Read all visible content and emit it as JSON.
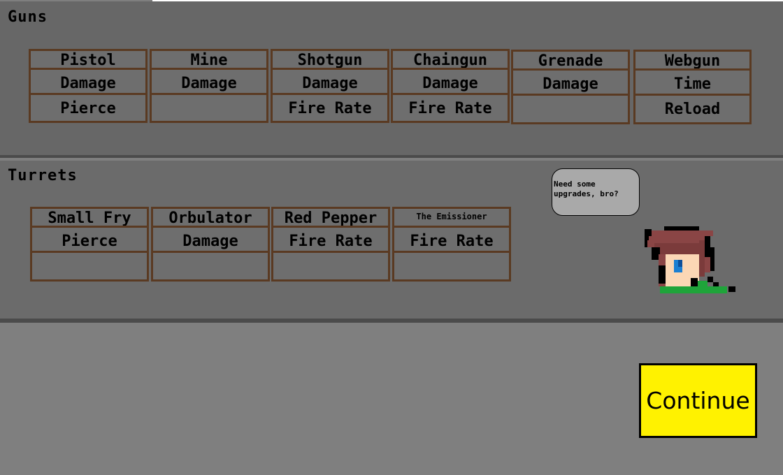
{
  "guns": {
    "title": "Guns",
    "items": [
      {
        "name": "Pistol",
        "upgrade1": "Damage",
        "upgrade2": "Pierce"
      },
      {
        "name": "Mine",
        "upgrade1": "Damage",
        "upgrade2": ""
      },
      {
        "name": "Shotgun",
        "upgrade1": "Damage",
        "upgrade2": "Fire Rate"
      },
      {
        "name": "Chaingun",
        "upgrade1": "Damage",
        "upgrade2": "Fire Rate"
      },
      {
        "name": "Grenade",
        "upgrade1": "Damage",
        "upgrade2": ""
      },
      {
        "name": "Webgun",
        "upgrade1": "Time",
        "upgrade2": "Reload"
      }
    ]
  },
  "turrets": {
    "title": "Turrets",
    "items": [
      {
        "name": "Small Fry",
        "upgrade1": "Pierce",
        "upgrade2": ""
      },
      {
        "name": "Orbulator",
        "upgrade1": "Damage",
        "upgrade2": ""
      },
      {
        "name": "Red Pepper",
        "upgrade1": "Fire Rate",
        "upgrade2": ""
      },
      {
        "name": "The Emissioner",
        "upgrade1": "Fire Rate",
        "upgrade2": ""
      }
    ]
  },
  "npc": {
    "speech_line1": "Need some",
    "speech_line2": "upgrades, bro?"
  },
  "continue_label": "Continue",
  "colors": {
    "card_border": "#5a3a22",
    "continue_bg": "#fff200",
    "npc_hair": "#8a4545",
    "npc_shirt": "#1fa43a"
  }
}
